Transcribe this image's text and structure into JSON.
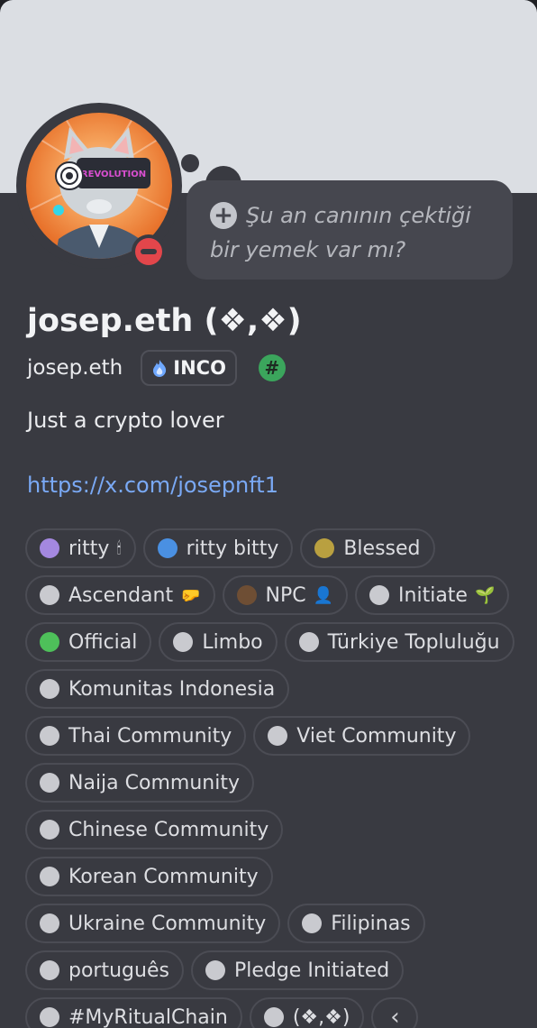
{
  "status": {
    "text": "Şu an canının çektiği bir yemek var mı?"
  },
  "profile": {
    "display_name": "josep.eth (❖,❖)",
    "username": "josep.eth",
    "guild_tag": "INCO",
    "badge_symbol": "#",
    "bio": "Just a crypto lover",
    "link": "https://x.com/josepnft1",
    "avatar_text": "REVOLUTION"
  },
  "roles": [
    {
      "name": "ritty",
      "color": "#a488e0",
      "emoji": "🕯"
    },
    {
      "name": "ritty bitty",
      "color": "#4a90e2"
    },
    {
      "name": "Blessed",
      "color": "#b9a040"
    },
    {
      "name": "Ascendant",
      "color": "#c9cacf",
      "emoji": "🤛"
    },
    {
      "name": "NPC",
      "color": "#6e4e34",
      "emoji": "👤"
    },
    {
      "name": "Initiate",
      "color": "#c9cacf",
      "emoji": "🌱"
    },
    {
      "name": "Official",
      "color": "#4ec05a"
    },
    {
      "name": "Limbo",
      "color": "#c9cacf"
    },
    {
      "name": "Türkiye Topluluğu",
      "color": "#c9cacf"
    },
    {
      "name": "Komunitas Indonesia",
      "color": "#c9cacf"
    },
    {
      "name": "Thai Community",
      "color": "#c9cacf"
    },
    {
      "name": "Viet Community",
      "color": "#c9cacf"
    },
    {
      "name": "Naija Community",
      "color": "#c9cacf"
    },
    {
      "name": "Chinese Community",
      "color": "#c9cacf"
    },
    {
      "name": "Korean Community",
      "color": "#c9cacf"
    },
    {
      "name": "Ukraine Community",
      "color": "#c9cacf"
    },
    {
      "name": "Filipinas",
      "color": "#c9cacf"
    },
    {
      "name": "português",
      "color": "#c9cacf"
    },
    {
      "name": "Pledge Initiated",
      "color": "#c9cacf"
    },
    {
      "name": "#MyRitualChain",
      "color": "#c9cacf"
    },
    {
      "name": "(❖,❖)",
      "color": "#c9cacf"
    }
  ],
  "roles_collapse_icon": "chevron-left-icon"
}
